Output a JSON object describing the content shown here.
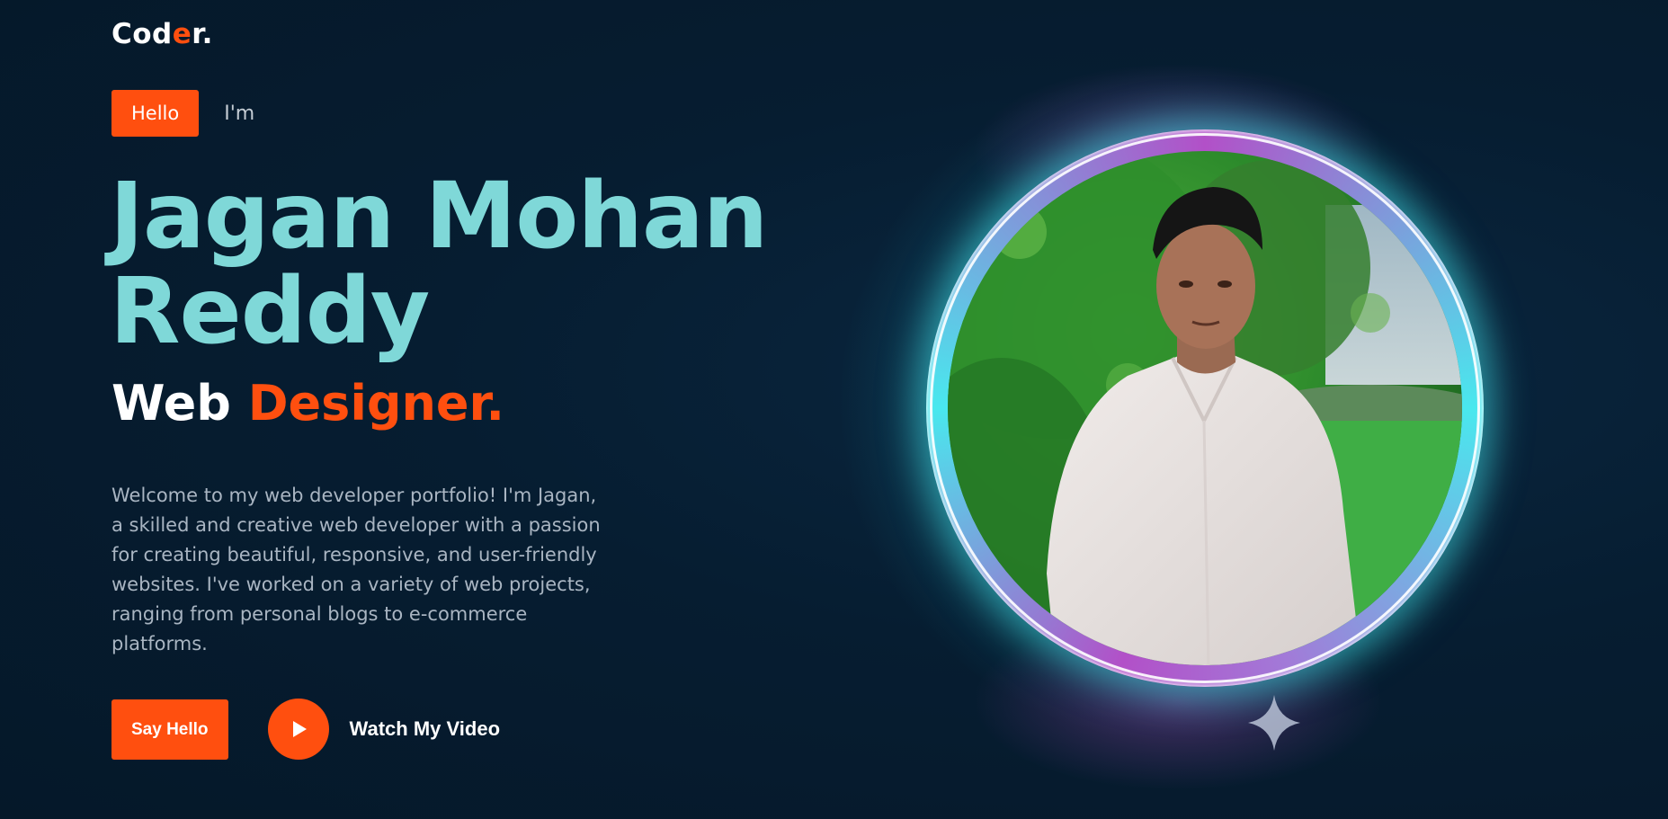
{
  "logo": {
    "part1": "Cod",
    "accent": "e",
    "part2": "r."
  },
  "greeting": {
    "badge": "Hello",
    "intro": "I'm"
  },
  "hero": {
    "name_line1": "Jagan Mohan",
    "name_line2": "Reddy",
    "role_word": "Web",
    "role_accent": "Designer.",
    "description": "Welcome to my web developer portfolio! I'm Jagan, a skilled and creative web developer with a passion for creating beautiful, responsive, and user-friendly websites. I've worked on a variety of web projects, ranging from personal blogs to e-commerce platforms."
  },
  "actions": {
    "say_hello": "Say Hello",
    "watch_video": "Watch My Video"
  },
  "icons": {
    "play": "play-icon",
    "sparkle": "sparkle-icon"
  },
  "colors": {
    "accent": "#ff4f0f",
    "name": "#7fd8d8",
    "background": "#051a2c",
    "ring_cyan": "#49e8ee",
    "ring_purple": "#b250c8"
  }
}
